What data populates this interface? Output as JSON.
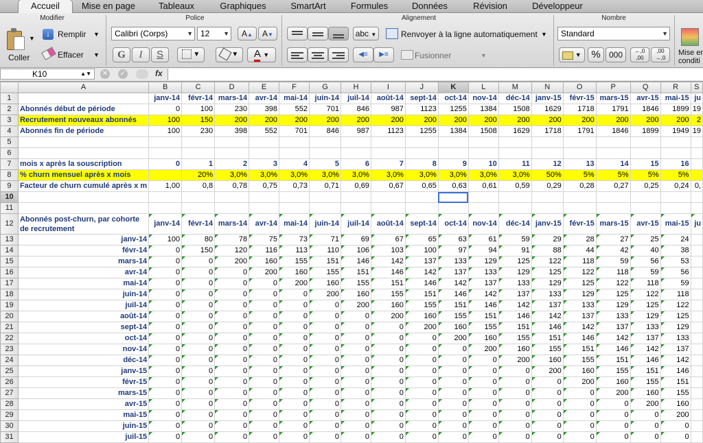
{
  "tabs": [
    "Accueil",
    "Mise en page",
    "Tableaux",
    "Graphiques",
    "SmartArt",
    "Formules",
    "Données",
    "Révision",
    "Développeur"
  ],
  "ribbon": {
    "groups": {
      "modifier": "Modifier",
      "police": "Police",
      "alignement": "Alignement",
      "nombre": "Nombre"
    },
    "coller": "Coller",
    "remplir": "Remplir",
    "effacer": "Effacer",
    "font": "Calibri (Corps)",
    "size": "12",
    "bold": "G",
    "italic": "I",
    "underline": "S",
    "wrap": "Renvoyer à la ligne automatiquement",
    "merge": "Fusionner",
    "orient": "abc",
    "format": "Standard",
    "percent": "%",
    "thousands": "000",
    "dec_inc": "←,0 ,00",
    "dec_dec": ",00 →,0",
    "cond": "Mise en forme conditionnelle",
    "cond_visible": "Mise en\ncondition"
  },
  "formula_bar": {
    "cell": "K10",
    "fx": "fx"
  },
  "columns": [
    "A",
    "B",
    "C",
    "D",
    "E",
    "F",
    "G",
    "H",
    "I",
    "J",
    "K",
    "L",
    "M",
    "N",
    "O",
    "P",
    "Q",
    "R",
    "S"
  ],
  "sheet": {
    "r1": [
      "janv-14",
      "févr-14",
      "mars-14",
      "avr-14",
      "mai-14",
      "juin-14",
      "juil-14",
      "août-14",
      "sept-14",
      "oct-14",
      "nov-14",
      "déc-14",
      "janv-15",
      "févr-15",
      "mars-15",
      "avr-15",
      "mai-15",
      "ju"
    ],
    "r2": {
      "label": "Abonnés début de période",
      "v": [
        "0",
        "100",
        "230",
        "398",
        "552",
        "701",
        "846",
        "987",
        "1123",
        "1255",
        "1384",
        "1508",
        "1629",
        "1718",
        "1791",
        "1846",
        "1899",
        "19"
      ]
    },
    "r3": {
      "label": "Recrutement nouveaux abonnés",
      "v": [
        "100",
        "150",
        "200",
        "200",
        "200",
        "200",
        "200",
        "200",
        "200",
        "200",
        "200",
        "200",
        "200",
        "200",
        "200",
        "200",
        "200",
        "2"
      ]
    },
    "r4": {
      "label": "Abonnés fin de période",
      "v": [
        "100",
        "230",
        "398",
        "552",
        "701",
        "846",
        "987",
        "1123",
        "1255",
        "1384",
        "1508",
        "1629",
        "1718",
        "1791",
        "1846",
        "1899",
        "1949",
        "19"
      ]
    },
    "r7": {
      "label": "mois x après la souscription",
      "v": [
        "0",
        "1",
        "2",
        "3",
        "4",
        "5",
        "6",
        "7",
        "8",
        "9",
        "10",
        "11",
        "12",
        "13",
        "14",
        "15",
        "16",
        ""
      ]
    },
    "r8": {
      "label": "% churn mensuel après x mois",
      "v": [
        "",
        "20%",
        "3,0%",
        "3,0%",
        "3,0%",
        "3,0%",
        "3,0%",
        "3,0%",
        "3,0%",
        "3,0%",
        "3,0%",
        "3,0%",
        "50%",
        "5%",
        "5%",
        "5%",
        "5%",
        ""
      ]
    },
    "r9": {
      "label": "Facteur de churn cumulé après x m",
      "v": [
        "1,00",
        "0,8",
        "0,78",
        "0,75",
        "0,73",
        "0,71",
        "0,69",
        "0,67",
        "0,65",
        "0,63",
        "0,61",
        "0,59",
        "0,29",
        "0,28",
        "0,27",
        "0,25",
        "0,24",
        "0,"
      ]
    },
    "r12": {
      "label": "Abonnés post-churn, par cohorte de recrutement",
      "v": [
        "janv-14",
        "févr-14",
        "mars-14",
        "avr-14",
        "mai-14",
        "juin-14",
        "juil-14",
        "août-14",
        "sept-14",
        "oct-14",
        "nov-14",
        "déc-14",
        "janv-15",
        "févr-15",
        "mars-15",
        "avr-15",
        "mai-15",
        "ju"
      ]
    },
    "cohorts": [
      {
        "label": "janv-14",
        "v": [
          "100",
          "80",
          "78",
          "75",
          "73",
          "71",
          "69",
          "67",
          "65",
          "63",
          "61",
          "59",
          "29",
          "28",
          "27",
          "25",
          "24",
          ""
        ]
      },
      {
        "label": "févr-14",
        "v": [
          "0",
          "150",
          "120",
          "116",
          "113",
          "110",
          "106",
          "103",
          "100",
          "97",
          "94",
          "91",
          "88",
          "44",
          "42",
          "40",
          "38",
          ""
        ]
      },
      {
        "label": "mars-14",
        "v": [
          "0",
          "0",
          "200",
          "160",
          "155",
          "151",
          "146",
          "142",
          "137",
          "133",
          "129",
          "125",
          "122",
          "118",
          "59",
          "56",
          "53",
          ""
        ]
      },
      {
        "label": "avr-14",
        "v": [
          "0",
          "0",
          "0",
          "200",
          "160",
          "155",
          "151",
          "146",
          "142",
          "137",
          "133",
          "129",
          "125",
          "122",
          "118",
          "59",
          "56",
          ""
        ]
      },
      {
        "label": "mai-14",
        "v": [
          "0",
          "0",
          "0",
          "0",
          "200",
          "160",
          "155",
          "151",
          "146",
          "142",
          "137",
          "133",
          "129",
          "125",
          "122",
          "118",
          "59",
          ""
        ]
      },
      {
        "label": "juin-14",
        "v": [
          "0",
          "0",
          "0",
          "0",
          "0",
          "200",
          "160",
          "155",
          "151",
          "146",
          "142",
          "137",
          "133",
          "129",
          "125",
          "122",
          "118",
          ""
        ]
      },
      {
        "label": "juil-14",
        "v": [
          "0",
          "0",
          "0",
          "0",
          "0",
          "0",
          "200",
          "160",
          "155",
          "151",
          "146",
          "142",
          "137",
          "133",
          "129",
          "125",
          "122",
          ""
        ]
      },
      {
        "label": "août-14",
        "v": [
          "0",
          "0",
          "0",
          "0",
          "0",
          "0",
          "0",
          "200",
          "160",
          "155",
          "151",
          "146",
          "142",
          "137",
          "133",
          "129",
          "125",
          ""
        ]
      },
      {
        "label": "sept-14",
        "v": [
          "0",
          "0",
          "0",
          "0",
          "0",
          "0",
          "0",
          "0",
          "200",
          "160",
          "155",
          "151",
          "146",
          "142",
          "137",
          "133",
          "129",
          ""
        ]
      },
      {
        "label": "oct-14",
        "v": [
          "0",
          "0",
          "0",
          "0",
          "0",
          "0",
          "0",
          "0",
          "0",
          "200",
          "160",
          "155",
          "151",
          "146",
          "142",
          "137",
          "133",
          ""
        ]
      },
      {
        "label": "nov-14",
        "v": [
          "0",
          "0",
          "0",
          "0",
          "0",
          "0",
          "0",
          "0",
          "0",
          "0",
          "200",
          "160",
          "155",
          "151",
          "146",
          "142",
          "137",
          ""
        ]
      },
      {
        "label": "déc-14",
        "v": [
          "0",
          "0",
          "0",
          "0",
          "0",
          "0",
          "0",
          "0",
          "0",
          "0",
          "0",
          "200",
          "160",
          "155",
          "151",
          "146",
          "142",
          ""
        ]
      },
      {
        "label": "janv-15",
        "v": [
          "0",
          "0",
          "0",
          "0",
          "0",
          "0",
          "0",
          "0",
          "0",
          "0",
          "0",
          "0",
          "200",
          "160",
          "155",
          "151",
          "146",
          ""
        ]
      },
      {
        "label": "févr-15",
        "v": [
          "0",
          "0",
          "0",
          "0",
          "0",
          "0",
          "0",
          "0",
          "0",
          "0",
          "0",
          "0",
          "0",
          "200",
          "160",
          "155",
          "151",
          ""
        ]
      },
      {
        "label": "mars-15",
        "v": [
          "0",
          "0",
          "0",
          "0",
          "0",
          "0",
          "0",
          "0",
          "0",
          "0",
          "0",
          "0",
          "0",
          "0",
          "200",
          "160",
          "155",
          ""
        ]
      },
      {
        "label": "avr-15",
        "v": [
          "0",
          "0",
          "0",
          "0",
          "0",
          "0",
          "0",
          "0",
          "0",
          "0",
          "0",
          "0",
          "0",
          "0",
          "0",
          "200",
          "160",
          ""
        ]
      },
      {
        "label": "mai-15",
        "v": [
          "0",
          "0",
          "0",
          "0",
          "0",
          "0",
          "0",
          "0",
          "0",
          "0",
          "0",
          "0",
          "0",
          "0",
          "0",
          "0",
          "200",
          ""
        ]
      },
      {
        "label": "juin-15",
        "v": [
          "0",
          "0",
          "0",
          "0",
          "0",
          "0",
          "0",
          "0",
          "0",
          "0",
          "0",
          "0",
          "0",
          "0",
          "0",
          "0",
          "0",
          ""
        ]
      },
      {
        "label": "juil-15",
        "v": [
          "0",
          "0",
          "0",
          "0",
          "0",
          "0",
          "0",
          "0",
          "0",
          "0",
          "0",
          "0",
          "0",
          "0",
          "0",
          "0",
          "0",
          ""
        ]
      }
    ]
  },
  "colors": {
    "highlight": "#ffff00",
    "label_blue": "#1f3a7a",
    "selection": "#3a6fd8",
    "comment_triangle": "#2a9a2a"
  }
}
